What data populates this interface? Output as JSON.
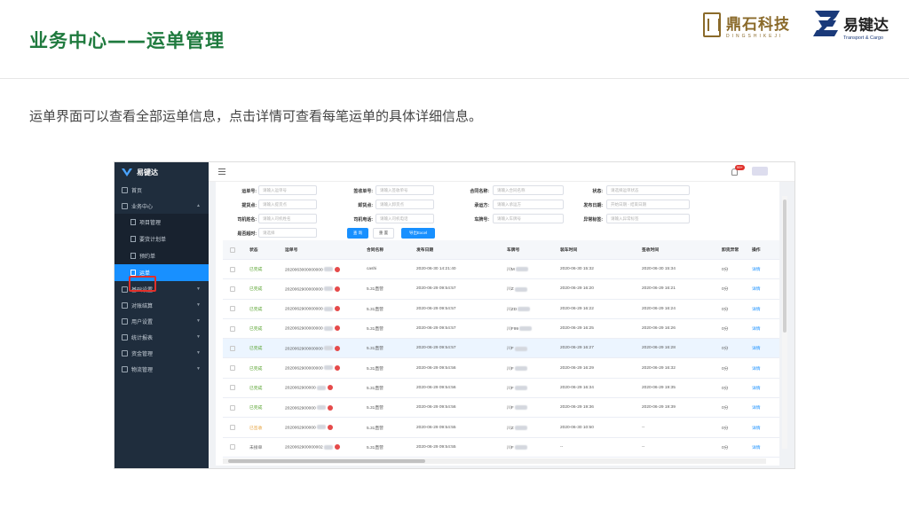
{
  "slide": {
    "title": "业务中心——运单管理",
    "description": "运单界面可以查看全部运单信息，点击详情可查看每笔运单的具体详细信息。"
  },
  "logos": {
    "logo1_cn": "鼎石科技",
    "logo1_en": "DINGSHIKEJI",
    "logo2_cn": "易键达",
    "logo2_en": "Transport & Cargo"
  },
  "app": {
    "brand": "易键达",
    "notification_badge": "99+",
    "sidebar": [
      {
        "label": "首页",
        "kind": "item"
      },
      {
        "label": "业务中心",
        "kind": "item",
        "caret": "▲"
      },
      {
        "label": "项目管理",
        "kind": "sub"
      },
      {
        "label": "要货计划单",
        "kind": "sub"
      },
      {
        "label": "预约单",
        "kind": "sub"
      },
      {
        "label": "运单",
        "kind": "sub",
        "active": true
      },
      {
        "label": "基础设置",
        "kind": "item",
        "caret": "▼"
      },
      {
        "label": "对账结算",
        "kind": "item",
        "caret": "▼"
      },
      {
        "label": "用户设置",
        "kind": "item",
        "caret": "▼"
      },
      {
        "label": "统计报表",
        "kind": "item",
        "caret": "▼"
      },
      {
        "label": "资金管理",
        "kind": "item",
        "caret": "▼"
      },
      {
        "label": "物流管理",
        "kind": "item",
        "caret": "▼"
      }
    ],
    "filters": {
      "waybill_no": {
        "label": "运单号:",
        "placeholder": "请输入运单号"
      },
      "sign_no": {
        "label": "签收单号:",
        "placeholder": "请输入签收单号"
      },
      "contract_name": {
        "label": "合同名称:",
        "placeholder": "请输入合同名称"
      },
      "status": {
        "label": "状态:",
        "placeholder": "请选择运单状态"
      },
      "pickup": {
        "label": "提货点:",
        "placeholder": "请输入提货点"
      },
      "unload": {
        "label": "卸货点:",
        "placeholder": "请输入卸货点"
      },
      "carrier": {
        "label": "承运方:",
        "placeholder": "请输入承运方"
      },
      "publish_date": {
        "label": "发布日期:",
        "start": "开始日期",
        "end": "结束日期"
      },
      "driver_name": {
        "label": "司机姓名:",
        "placeholder": "请输入司机姓名"
      },
      "driver_phone": {
        "label": "司机电话:",
        "placeholder": "请输入司机电话"
      },
      "plate_no": {
        "label": "车牌号:",
        "placeholder": "请输入车牌号"
      },
      "exception": {
        "label": "异常标签:",
        "placeholder": "请输入异常标签"
      },
      "overtime": {
        "label": "是否超时:",
        "placeholder": "请选择"
      },
      "query_btn": "查 询",
      "reset_btn": "重 置",
      "export_btn": "导出Excel"
    },
    "table": {
      "headers": [
        "状态",
        "运单号",
        "合同名称",
        "发布日期",
        "车牌号",
        "装车时间",
        "签收时间",
        "卸货异常",
        "操作"
      ],
      "rows": [
        {
          "status": "已完成",
          "status_kind": "ok",
          "waybill": "2020063000000000",
          "contract": "cashi",
          "date": "2020-06-30 14:21:40",
          "plate": "川M",
          "load": "2020-06-30 15:32",
          "sign": "2020-06-30 15:34",
          "exc": "0分",
          "op": "详情"
        },
        {
          "status": "已完成",
          "status_kind": "ok",
          "waybill": "2020062900000000",
          "contract": "5.31直营",
          "date": "2020-06-29 09:54:57",
          "plate": "川Z",
          "load": "2020-06-29 16:20",
          "sign": "2020-06-29 16:21",
          "exc": "0分",
          "op": "详情"
        },
        {
          "status": "已完成",
          "status_kind": "ok",
          "waybill": "2020062900000000",
          "contract": "5.31直营",
          "date": "2020-06-29 09:54:57",
          "plate": "川ZD",
          "load": "2020-06-29 16:22",
          "sign": "2020-06-29 16:24",
          "exc": "0分",
          "op": "详情"
        },
        {
          "status": "已完成",
          "status_kind": "ok",
          "waybill": "2020062900000000",
          "contract": "5.31直营",
          "date": "2020-06-29 09:54:57",
          "plate": "川F99",
          "load": "2020-06-29 16:25",
          "sign": "2020-06-29 16:26",
          "exc": "0分",
          "op": "详情"
        },
        {
          "status": "已完成",
          "status_kind": "ok",
          "waybill": "2020062900000000",
          "contract": "5.31直营",
          "date": "2020-06-29 09:54:57",
          "plate": "川F",
          "load": "2020-06-29 16:27",
          "sign": "2020-06-29 16:28",
          "exc": "0分",
          "op": "详情"
        },
        {
          "status": "已完成",
          "status_kind": "ok",
          "waybill": "2020062900000000",
          "contract": "5.31直营",
          "date": "2020-06-29 09:54:56",
          "plate": "川F",
          "load": "2020-06-29 16:29",
          "sign": "2020-06-29 16:32",
          "exc": "0分",
          "op": "详情"
        },
        {
          "status": "已完成",
          "status_kind": "ok",
          "waybill": "2020062900000",
          "contract": "5.31直营",
          "date": "2020-06-29 09:54:56",
          "plate": "川F",
          "load": "2020-06-29 16:34",
          "sign": "2020-06-29 19:35",
          "exc": "0分",
          "op": "详情"
        },
        {
          "status": "已完成",
          "status_kind": "ok",
          "waybill": "2020062900000",
          "contract": "5.31直营",
          "date": "2020-06-29 09:54:56",
          "plate": "川F",
          "load": "2020-06-29 19:36",
          "sign": "2020-06-29 19:39",
          "exc": "0分",
          "op": "详情"
        },
        {
          "status": "已签收",
          "status_kind": "warn",
          "waybill": "2020062900000",
          "contract": "5.31直营",
          "date": "2020-06-29 09:54:55",
          "plate": "川Z",
          "load": "2020-06-30 10:50",
          "sign": "--",
          "exc": "0分",
          "op": "详情"
        },
        {
          "status": "未接单",
          "status_kind": "def",
          "waybill": "2020062900000002",
          "contract": "5.31直营",
          "date": "2020-06-29 09:54:55",
          "plate": "川F",
          "load": "--",
          "sign": "--",
          "exc": "0分",
          "op": "详情"
        }
      ]
    }
  }
}
